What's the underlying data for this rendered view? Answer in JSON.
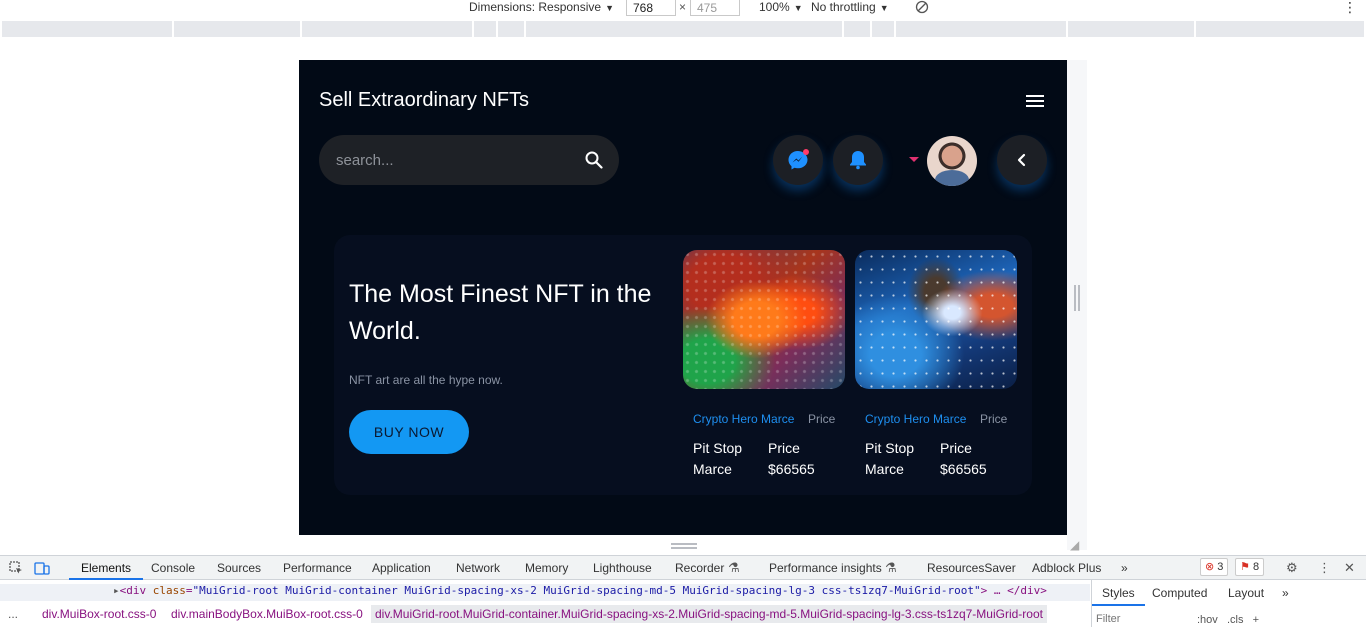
{
  "device_toolbar": {
    "dimensions_label": "Dimensions: Responsive",
    "width": "768",
    "height": "475",
    "times": "×",
    "zoom": "100%",
    "throttling": "No throttling",
    "caret": "▼",
    "kebab": "⋮"
  },
  "site": {
    "brand": "Sell Extraordinary NFTs",
    "search_placeholder": "search...",
    "hero": {
      "title": "The Most Finest NFT in the World.",
      "subtitle": "NFT art are all the hype now.",
      "button": "BUY NOW"
    },
    "cards": [
      {
        "creator": "Crypto Hero Marce",
        "price_label": "Price",
        "name": "Pit Stop Marce",
        "price_title": "Price",
        "price": "$66565"
      },
      {
        "creator": "Crypto Hero Marce",
        "price_label": "Price",
        "name": "Pit Stop Marce",
        "price_title": "Price",
        "price": "$66565"
      }
    ]
  },
  "devtools": {
    "tabs": [
      "Elements",
      "Console",
      "Sources",
      "Performance",
      "Application",
      "Network",
      "Memory",
      "Lighthouse",
      "Recorder",
      "Performance insights",
      "ResourcesSaver",
      "Adblock Plus"
    ],
    "more": "»",
    "errors": "3",
    "issues": "8",
    "dom_line": {
      "open": "<div ",
      "attr": "class",
      "eq": "=",
      "value": "\"MuiGrid-root MuiGrid-container MuiGrid-spacing-xs-2 MuiGrid-spacing-md-5 MuiGrid-spacing-lg-3 css-ts1zq7-MuiGrid-root\"",
      "close": "> … </div>"
    },
    "breadcrumbs": [
      "div.MuiBox-root.css-0",
      "div.mainBodyBox.MuiBox-root.css-0",
      "div.MuiGrid-root.MuiGrid-container.MuiGrid-spacing-xs-2.MuiGrid-spacing-md-5.MuiGrid-spacing-lg-3.css-ts1zq7-MuiGrid-root"
    ],
    "ellipsis": "...",
    "styles_tabs": [
      "Styles",
      "Computed",
      "Layout"
    ],
    "filter_placeholder": "Filter",
    "hov": ":hov",
    "cls": ".cls",
    "plus": "+"
  }
}
